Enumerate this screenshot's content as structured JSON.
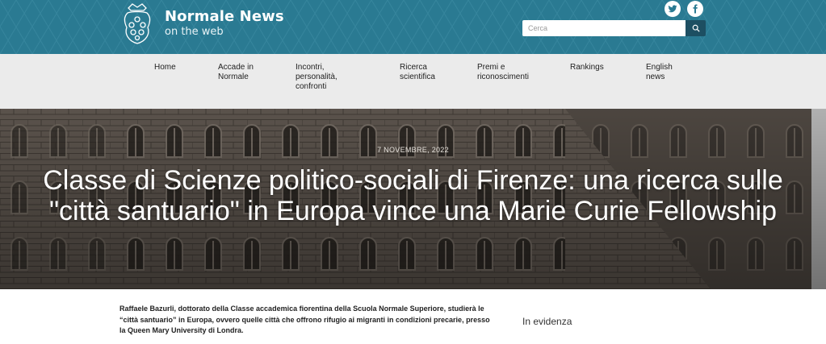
{
  "header": {
    "brand_title": "Normale News",
    "brand_subtitle": "on the web",
    "search": {
      "placeholder": "Cerca"
    },
    "social": [
      "twitter-icon",
      "facebook-icon"
    ],
    "colors": {
      "header_bg": "#2a7a92",
      "search_button": "#1d4f62",
      "nav_bg": "#ebebeb"
    }
  },
  "nav": {
    "items": [
      {
        "label": "Home"
      },
      {
        "label": "Accade in\nNormale"
      },
      {
        "label": "Incontri,\npersonalità,\nconfronti"
      },
      {
        "label": "Ricerca\nscientifica"
      },
      {
        "label": "Premi e\nriconoscimenti"
      },
      {
        "label": "Rankings"
      },
      {
        "label": "English\nnews"
      }
    ]
  },
  "article": {
    "date": "7 NOVEMBRE, 2022",
    "title": "Classe di Scienze politico-sociali di Firenze: una ricerca sulle \"città santuario\" in Europa vince una Marie Curie Fellowship",
    "intro": "Raffaele Bazurli, dottorato della Classe accademica fiorentina della Scuola Normale Superiore, studierà le “città santuario” in Europa, ovvero quelle città che offrono rifugio ai migranti in condizioni precarie, presso la Queen Mary University di Londra."
  },
  "sidebar": {
    "heading": "In evidenza"
  }
}
